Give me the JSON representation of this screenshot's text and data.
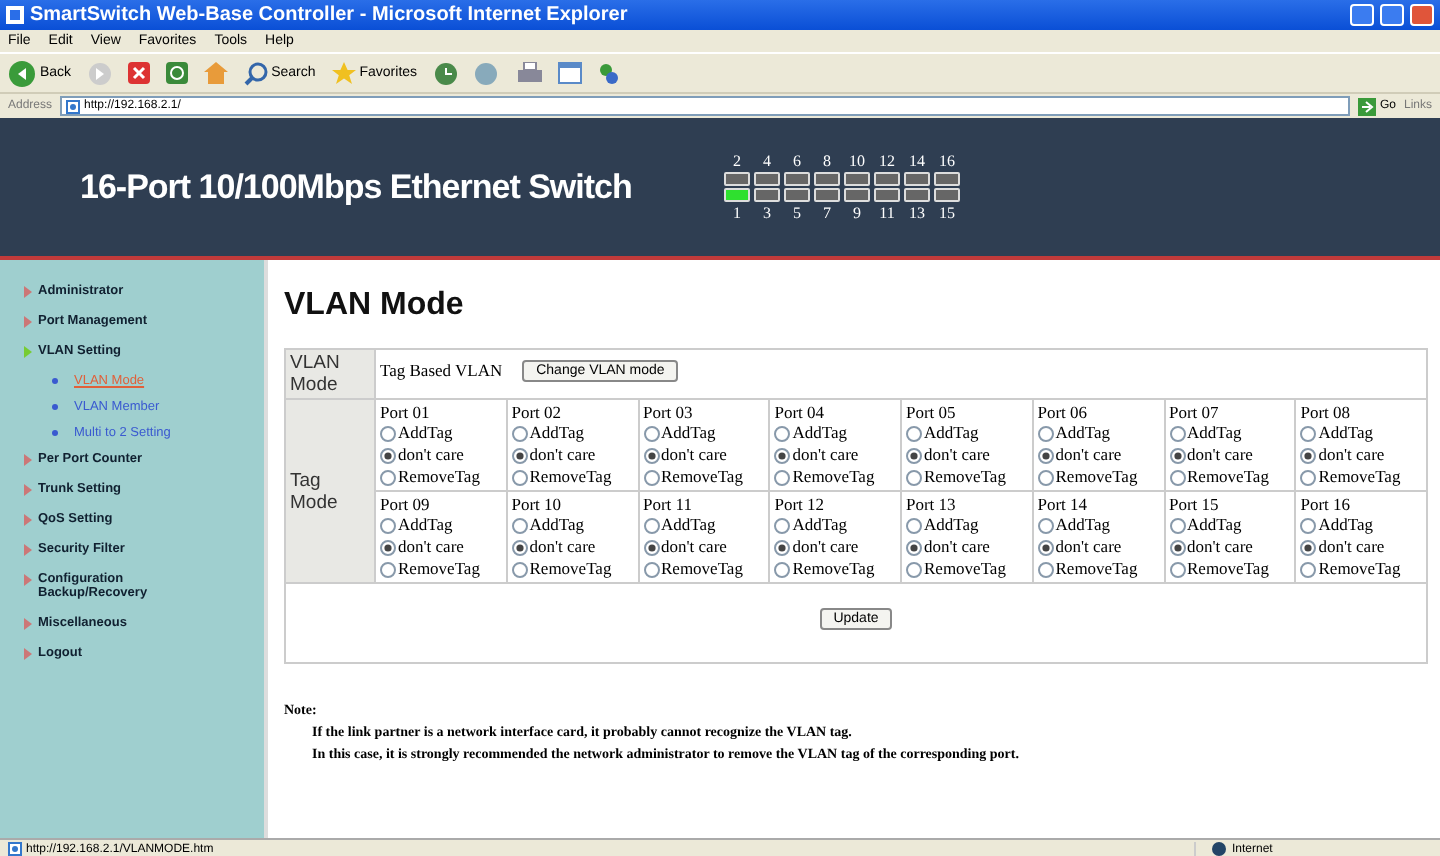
{
  "window": {
    "title": "SmartSwitch Web-Base Controller - Microsoft Internet Explorer"
  },
  "menu": [
    "File",
    "Edit",
    "View",
    "Favorites",
    "Tools",
    "Help"
  ],
  "toolbar": {
    "back": "Back",
    "search": "Search",
    "favorites": "Favorites"
  },
  "address": {
    "label": "Address",
    "url": "http://192.168.2.1/",
    "go": "Go",
    "links": "Links"
  },
  "banner": {
    "title": "16-Port 10/100Mbps Ethernet Switch",
    "top_labels": [
      "2",
      "4",
      "6",
      "8",
      "10",
      "12",
      "14",
      "16"
    ],
    "bottom_labels": [
      "1",
      "3",
      "5",
      "7",
      "9",
      "11",
      "13",
      "15"
    ],
    "top_ports": [
      {
        "link": false
      },
      {
        "link": false
      },
      {
        "link": false
      },
      {
        "link": false
      },
      {
        "link": false
      },
      {
        "link": false
      },
      {
        "link": false
      },
      {
        "link": false
      }
    ],
    "bottom_ports": [
      {
        "link": true
      },
      {
        "link": false
      },
      {
        "link": false
      },
      {
        "link": false
      },
      {
        "link": false
      },
      {
        "link": false
      },
      {
        "link": false
      },
      {
        "link": false
      }
    ]
  },
  "sidebar": {
    "items": [
      {
        "label": "Administrator",
        "expanded": false
      },
      {
        "label": "Port Management",
        "expanded": false
      },
      {
        "label": "VLAN Setting",
        "expanded": true,
        "children": [
          {
            "label": "VLAN Mode",
            "selected": true
          },
          {
            "label": "VLAN Member",
            "selected": false
          },
          {
            "label": "Multi to 2 Setting",
            "selected": false
          }
        ]
      },
      {
        "label": "Per Port Counter",
        "expanded": false
      },
      {
        "label": "Trunk Setting",
        "expanded": false
      },
      {
        "label": "QoS Setting",
        "expanded": false
      },
      {
        "label": "Security Filter",
        "expanded": false
      },
      {
        "label": "Configuration Backup/Recovery",
        "expanded": false
      },
      {
        "label": "Miscellaneous",
        "expanded": false
      },
      {
        "label": "Logout",
        "expanded": false
      }
    ]
  },
  "content": {
    "heading": "VLAN Mode",
    "vlan_mode_label": "VLAN Mode",
    "vlan_mode_value": "Tag Based VLAN",
    "change_button": "Change VLAN mode",
    "tag_mode_label": "Tag Mode",
    "ports": [
      {
        "name": "Port 01",
        "options": [
          {
            "label": "AddTag",
            "selected": false
          },
          {
            "label": "don't care",
            "selected": true
          },
          {
            "label": "RemoveTag",
            "selected": false
          }
        ]
      },
      {
        "name": "Port 02",
        "options": [
          {
            "label": "AddTag",
            "selected": false
          },
          {
            "label": "don't care",
            "selected": true
          },
          {
            "label": "RemoveTag",
            "selected": false
          }
        ]
      },
      {
        "name": "Port 03",
        "options": [
          {
            "label": "AddTag",
            "selected": false
          },
          {
            "label": "don't care",
            "selected": true
          },
          {
            "label": "RemoveTag",
            "selected": false
          }
        ]
      },
      {
        "name": "Port 04",
        "options": [
          {
            "label": "AddTag",
            "selected": false
          },
          {
            "label": "don't care",
            "selected": true
          },
          {
            "label": "RemoveTag",
            "selected": false
          }
        ]
      },
      {
        "name": "Port 05",
        "options": [
          {
            "label": "AddTag",
            "selected": false
          },
          {
            "label": "don't care",
            "selected": true
          },
          {
            "label": "RemoveTag",
            "selected": false
          }
        ]
      },
      {
        "name": "Port 06",
        "options": [
          {
            "label": "AddTag",
            "selected": false
          },
          {
            "label": "don't care",
            "selected": true
          },
          {
            "label": "RemoveTag",
            "selected": false
          }
        ]
      },
      {
        "name": "Port 07",
        "options": [
          {
            "label": "AddTag",
            "selected": false
          },
          {
            "label": "don't care",
            "selected": true
          },
          {
            "label": "RemoveTag",
            "selected": false
          }
        ]
      },
      {
        "name": "Port 08",
        "options": [
          {
            "label": "AddTag",
            "selected": false
          },
          {
            "label": "don't care",
            "selected": true
          },
          {
            "label": "RemoveTag",
            "selected": false
          }
        ]
      },
      {
        "name": "Port 09",
        "options": [
          {
            "label": "AddTag",
            "selected": false
          },
          {
            "label": "don't care",
            "selected": true
          },
          {
            "label": "RemoveTag",
            "selected": false
          }
        ]
      },
      {
        "name": "Port 10",
        "options": [
          {
            "label": "AddTag",
            "selected": false
          },
          {
            "label": "don't care",
            "selected": true
          },
          {
            "label": "RemoveTag",
            "selected": false
          }
        ]
      },
      {
        "name": "Port 11",
        "options": [
          {
            "label": "AddTag",
            "selected": false
          },
          {
            "label": "don't care",
            "selected": true
          },
          {
            "label": "RemoveTag",
            "selected": false
          }
        ]
      },
      {
        "name": "Port 12",
        "options": [
          {
            "label": "AddTag",
            "selected": false
          },
          {
            "label": "don't care",
            "selected": true
          },
          {
            "label": "RemoveTag",
            "selected": false
          }
        ]
      },
      {
        "name": "Port 13",
        "options": [
          {
            "label": "AddTag",
            "selected": false
          },
          {
            "label": "don't care",
            "selected": true
          },
          {
            "label": "RemoveTag",
            "selected": false
          }
        ]
      },
      {
        "name": "Port 14",
        "options": [
          {
            "label": "AddTag",
            "selected": false
          },
          {
            "label": "don't care",
            "selected": true
          },
          {
            "label": "RemoveTag",
            "selected": false
          }
        ]
      },
      {
        "name": "Port 15",
        "options": [
          {
            "label": "AddTag",
            "selected": false
          },
          {
            "label": "don't care",
            "selected": true
          },
          {
            "label": "RemoveTag",
            "selected": false
          }
        ]
      },
      {
        "name": "Port 16",
        "options": [
          {
            "label": "AddTag",
            "selected": false
          },
          {
            "label": "don't care",
            "selected": true
          },
          {
            "label": "RemoveTag",
            "selected": false
          }
        ]
      }
    ],
    "update_button": "Update",
    "note": {
      "title": "Note:",
      "lines": [
        "If the link partner is a network interface card, it probably cannot recognize the VLAN tag.",
        "In this case, it is strongly recommended the network administrator to remove the VLAN tag of the corresponding port."
      ]
    }
  },
  "status_bar": {
    "url": "http://192.168.2.1/VLANMODE.htm",
    "zone": "Internet"
  }
}
